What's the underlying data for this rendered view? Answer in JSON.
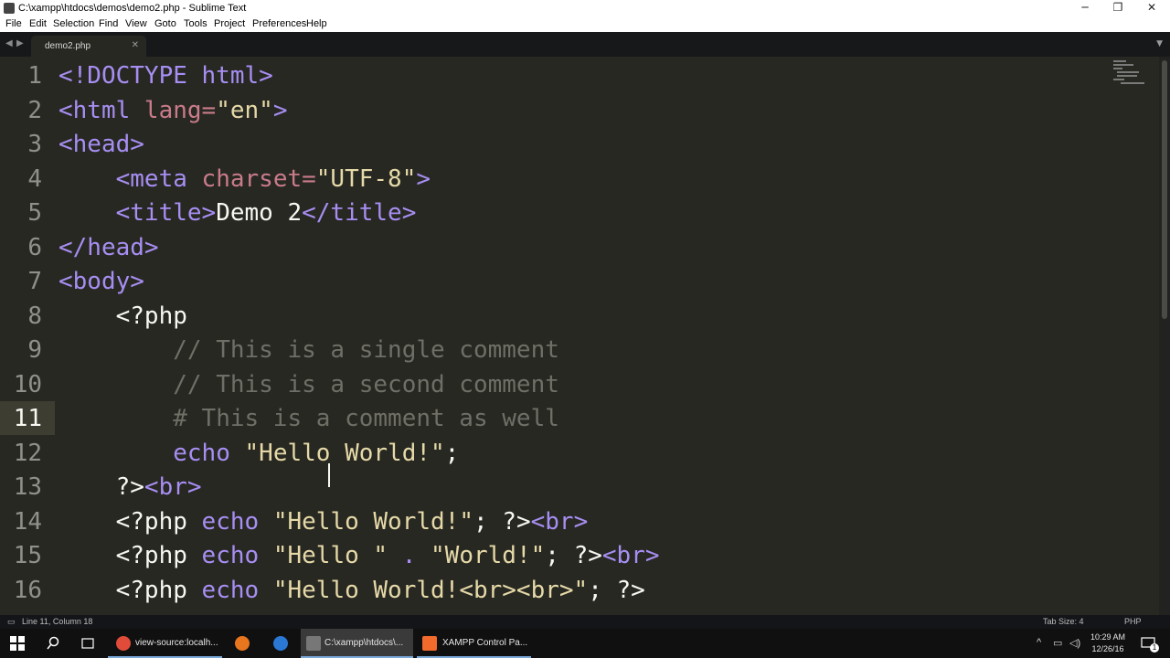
{
  "window": {
    "title": "C:\\xampp\\htdocs\\demos\\demo2.php - Sublime Text",
    "minimize": "─",
    "maximize": "❐",
    "close": "✕"
  },
  "menu": [
    "File",
    "Edit",
    "Selection",
    "Find",
    "View",
    "Goto",
    "Tools",
    "Project",
    "Preferences",
    "Help"
  ],
  "tabs": {
    "prev": "◀",
    "next": "▶",
    "active_tab": "demo2.php",
    "close": "✕",
    "dropdown": "▼"
  },
  "editor": {
    "current_line": 11,
    "lines": [
      {
        "n": "1",
        "tokens": [
          [
            "tag",
            "<!DOCTYPE html>"
          ]
        ]
      },
      {
        "n": "2",
        "tokens": [
          [
            "tag",
            "<html "
          ],
          [
            "attr",
            "lang="
          ],
          [
            "str",
            "\"en\""
          ],
          [
            "tag",
            ">"
          ]
        ]
      },
      {
        "n": "3",
        "tokens": [
          [
            "tag",
            "<head>"
          ]
        ]
      },
      {
        "n": "4",
        "tokens": [
          [
            "fg",
            "    "
          ],
          [
            "tag",
            "<meta "
          ],
          [
            "attr",
            "charset="
          ],
          [
            "str",
            "\"UTF-8\""
          ],
          [
            "tag",
            ">"
          ]
        ]
      },
      {
        "n": "5",
        "tokens": [
          [
            "fg",
            "    "
          ],
          [
            "tag",
            "<title>"
          ],
          [
            "fg",
            "Demo 2"
          ],
          [
            "tag",
            "</title>"
          ]
        ]
      },
      {
        "n": "6",
        "tokens": [
          [
            "tag",
            "</head>"
          ]
        ]
      },
      {
        "n": "7",
        "tokens": [
          [
            "tag",
            "<body>"
          ]
        ]
      },
      {
        "n": "8",
        "tokens": [
          [
            "fg",
            "    <?php"
          ]
        ]
      },
      {
        "n": "9",
        "tokens": [
          [
            "fg",
            "        "
          ],
          [
            "com",
            "// This is a single comment"
          ]
        ]
      },
      {
        "n": "10",
        "tokens": [
          [
            "fg",
            "        "
          ],
          [
            "com",
            "// This is a second comment"
          ]
        ]
      },
      {
        "n": "11",
        "tokens": [
          [
            "fg",
            "        "
          ],
          [
            "com",
            "# This is a comment as well"
          ]
        ]
      },
      {
        "n": "12",
        "tokens": [
          [
            "fg",
            "        "
          ],
          [
            "kw",
            "echo "
          ],
          [
            "str",
            "\"Hello World!\""
          ],
          [
            "fg",
            ";"
          ]
        ]
      },
      {
        "n": "13",
        "tokens": [
          [
            "fg",
            "    ?>"
          ],
          [
            "tag",
            "<br>"
          ]
        ]
      },
      {
        "n": "14",
        "tokens": [
          [
            "fg",
            "    <?php "
          ],
          [
            "kw",
            "echo "
          ],
          [
            "str",
            "\"Hello World!\""
          ],
          [
            "fg",
            "; ?>"
          ],
          [
            "tag",
            "<br>"
          ]
        ]
      },
      {
        "n": "15",
        "tokens": [
          [
            "fg",
            "    <?php "
          ],
          [
            "kw",
            "echo "
          ],
          [
            "str",
            "\"Hello \""
          ],
          [
            "op",
            " . "
          ],
          [
            "str",
            "\"World!\""
          ],
          [
            "fg",
            "; ?>"
          ],
          [
            "tag",
            "<br>"
          ]
        ]
      },
      {
        "n": "16",
        "tokens": [
          [
            "fg",
            "    <?php "
          ],
          [
            "kw",
            "echo "
          ],
          [
            "str",
            "\"Hello World!<br><br>\""
          ],
          [
            "fg",
            "; ?>"
          ]
        ]
      }
    ]
  },
  "statusbar": {
    "position": "Line 11, Column 18",
    "tab_size": "Tab Size: 4",
    "syntax": "PHP"
  },
  "taskbar": {
    "items": [
      {
        "name": "chrome",
        "label": "view-source:localh...",
        "color": "#e04b3a"
      },
      {
        "name": "firefox",
        "label": "",
        "color": "#e8761f"
      },
      {
        "name": "edge",
        "label": "",
        "color": "#2a78d4"
      },
      {
        "name": "sublime",
        "label": "C:\\xampp\\htdocs\\...",
        "color": "#5a5a5a"
      },
      {
        "name": "xampp",
        "label": "XAMPP Control Pa...",
        "color": "#f26b2c"
      }
    ],
    "time": "10:29 AM",
    "date": "12/26/16",
    "notification_count": "1"
  },
  "colors": {
    "editor_bg": "#272822",
    "tag": "#a78ef2",
    "attr": "#c97b8a",
    "string": "#e6d9a8",
    "comment": "#6f6f66"
  }
}
